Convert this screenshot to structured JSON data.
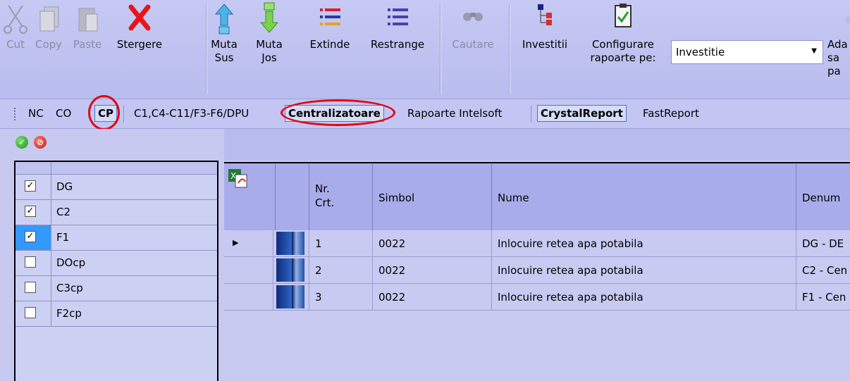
{
  "toolbar": {
    "cut": "Cut",
    "copy": "Copy",
    "paste": "Paste",
    "stergere": "Stergere",
    "muta_sus": "Muta\nSus",
    "muta_jos": "Muta\nJos",
    "extinde": "Extinde",
    "restrange": "Restrange",
    "cautare": "Cautare",
    "investitii": "Investitii",
    "configurare": "Configurare\nrapoarte pe:",
    "combo_value": "Investitie",
    "partial": "Ada\nsa\npa"
  },
  "tabs": {
    "nc": "NC",
    "co": "CO",
    "cp": "CP",
    "c1": "C1,C4-C11/F3-F6/DPU",
    "centralizatoare": "Centralizatoare",
    "rapoarte": "Rapoarte Intelsoft",
    "crystal": "CrystalReport",
    "fast": "FastReport"
  },
  "left_list": [
    {
      "label": "DG",
      "checked": true
    },
    {
      "label": "C2",
      "checked": true
    },
    {
      "label": "F1",
      "checked": true
    },
    {
      "label": "DOcp",
      "checked": false
    },
    {
      "label": "C3cp",
      "checked": false
    },
    {
      "label": "F2cp",
      "checked": false
    }
  ],
  "grid": {
    "headers": {
      "nr": "Nr.\nCrt.",
      "simbol": "Simbol",
      "nume": "Nume",
      "denum": "Denum"
    },
    "rows": [
      {
        "nr": "1",
        "simbol": "0022",
        "nume": "Inlocuire retea apa potabila",
        "denum": "DG - DE"
      },
      {
        "nr": "2",
        "simbol": "0022",
        "nume": "Inlocuire retea apa potabila",
        "denum": "C2 - Cen"
      },
      {
        "nr": "3",
        "simbol": "0022",
        "nume": "Inlocuire retea apa potabila",
        "denum": "F1 - Cen"
      }
    ]
  },
  "colors": {
    "annotation_red": "#e30613",
    "selection_blue": "#3399ff"
  }
}
